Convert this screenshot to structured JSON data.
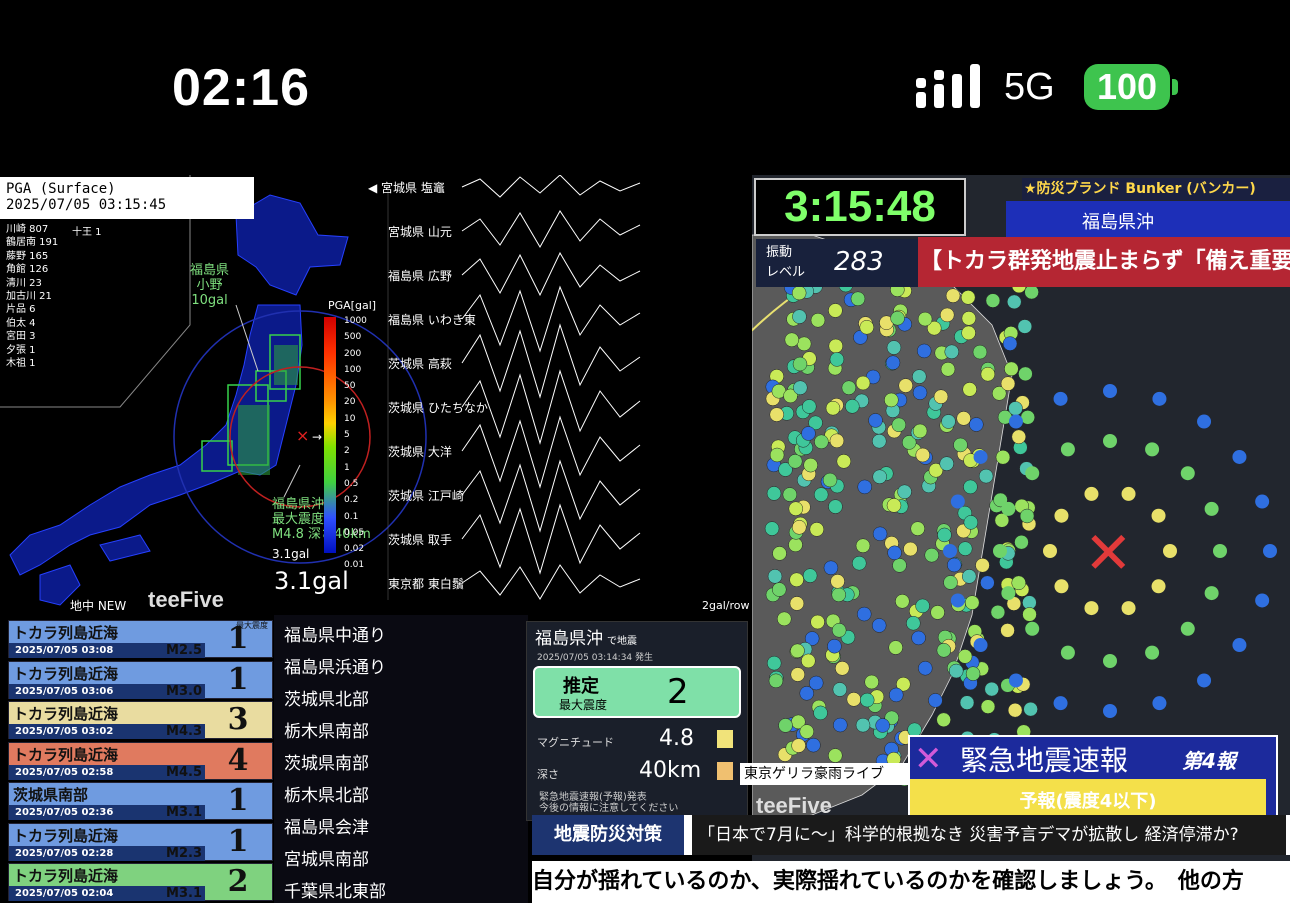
{
  "status_bar": {
    "time": "02:16",
    "network": "5G",
    "battery": "100"
  },
  "seismic": {
    "title_line1": "PGA (Surface)",
    "title_line2": "2025/07/05 03:15:45",
    "stations_left": [
      "川崎 807",
      "鶴居南 191",
      "藤野 165",
      "角館 126",
      "清川 23",
      "加古川 21",
      "片品 6",
      "伯太 4",
      "宮田 3",
      "夕張 1",
      "木祖 1"
    ],
    "stations_right": [
      "十王 1"
    ],
    "annotation_top": [
      "福島県",
      "小野",
      "10gal"
    ],
    "annotation_epicenter": [
      "福島県沖",
      "最大震度2",
      "M4.8 深さ40km"
    ],
    "scale_title": "PGA[gal]",
    "scale_ticks": [
      "1000",
      "500",
      "200",
      "100",
      "50",
      "20",
      "10",
      "5",
      "2",
      "1",
      "0.5",
      "0.2",
      "0.1",
      "0.05",
      "0.02",
      "0.01"
    ],
    "gal_small": "3.1gal",
    "gal_big": "3.1gal",
    "new_label": "地中 NEW",
    "brand": "teeFive",
    "wave_stations": [
      "◀ 宮城県 塩竈",
      "宮城県 山元",
      "福島県 広野",
      "福島県 いわき東",
      "茨城県 高萩",
      "茨城県 ひたちなか",
      "茨城県 大洋",
      "茨城県 江戸崎",
      "茨城県 取手",
      "東京都 東白鬚"
    ],
    "row_unit": "2gal/row"
  },
  "events": {
    "header": "最大震度",
    "items": [
      {
        "name": "トカラ列島近海",
        "date": "2025/07/05 03:08",
        "mag": "M2.5",
        "shindo": "1",
        "color": "#6f9be0"
      },
      {
        "name": "トカラ列島近海",
        "date": "2025/07/05 03:06",
        "mag": "M3.0",
        "shindo": "1",
        "color": "#6f9be0"
      },
      {
        "name": "トカラ列島近海",
        "date": "2025/07/05 03:02",
        "mag": "M4.3",
        "shindo": "3",
        "color": "#e9dca0"
      },
      {
        "name": "トカラ列島近海",
        "date": "2025/07/05 02:58",
        "mag": "M4.5",
        "shindo": "4",
        "color": "#e07a5f"
      },
      {
        "name": "茨城県南部",
        "date": "2025/07/05 02:36",
        "mag": "M3.1",
        "shindo": "1",
        "color": "#6f9be0"
      },
      {
        "name": "トカラ列島近海",
        "date": "2025/07/05 02:28",
        "mag": "M2.3",
        "shindo": "1",
        "color": "#6f9be0"
      },
      {
        "name": "トカラ列島近海",
        "date": "2025/07/05 02:04",
        "mag": "M3.1",
        "shindo": "2",
        "color": "#7fd27f"
      }
    ]
  },
  "regions": [
    "福島県中通り",
    "福島県浜通り",
    "茨城県北部",
    "栃木県南部",
    "茨城県南部",
    "栃木県北部",
    "福島県会津",
    "宮城県南部",
    "千葉県北東部"
  ],
  "info": {
    "place": "福島県沖",
    "place_suffix": "で地震",
    "date": "2025/07/05 03:14:34 発生",
    "shindo_label1": "推定",
    "shindo_label2": "最大震度",
    "shindo_value": "2",
    "mag_label": "マグニチュード",
    "mag_value": "4.8",
    "depth_label": "深さ",
    "depth_value": "40km",
    "note_line1": "緊急地震速報(予報)発表",
    "note_line2": "今後の情報に注意してください"
  },
  "right": {
    "clock": "3:15:48",
    "sponsor": "★防災ブランド Bunker (バンカー)",
    "sponsor_sub": "福島県沖",
    "shaking_label": [
      "振動",
      "レベル"
    ],
    "shaking_value": "283",
    "headline": "【トカラ群発地震止まらず「備え重要」】",
    "eew_title": "緊急地震速報",
    "eew_number": "第4報",
    "eew_forecast": "予報(震度4以下)",
    "brand": "teeFive"
  },
  "guerrilla_label": "東京ゲリラ豪雨ライブ",
  "ticker": {
    "tag": "地震防災対策",
    "headline": "「日本で7月に〜」科学的根拠なき 災害予言デマが拡散し 経済停滞か?",
    "scroll": "自分が揺れているのか、実際揺れているのかを確認しましょう。　他の方"
  }
}
